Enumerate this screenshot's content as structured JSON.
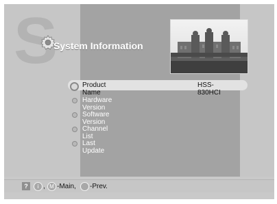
{
  "header": {
    "watermark_letter": "S",
    "title": "System Information"
  },
  "menu": {
    "items": [
      {
        "label": "Product Name",
        "value": "HSS-830HCI"
      },
      {
        "label": "Hardware Version"
      },
      {
        "label": "Software Version"
      },
      {
        "label": "Channel List"
      },
      {
        "label": "Last Update"
      }
    ]
  },
  "footer": {
    "help_glyph": "?",
    "info_glyph": "i",
    "main_glyph": "M",
    "sep1": ",",
    "main_label": "-Main,",
    "prev_label": "-Prev."
  },
  "icons": [
    "gear-icon",
    "help-icon",
    "info-icon",
    "menu-button-icon",
    "back-button-icon"
  ],
  "colors": {
    "background": "#c9c9c9",
    "center_band": "#a3a3a3",
    "highlight": "#e2e2e2",
    "title": "#ffffff"
  }
}
